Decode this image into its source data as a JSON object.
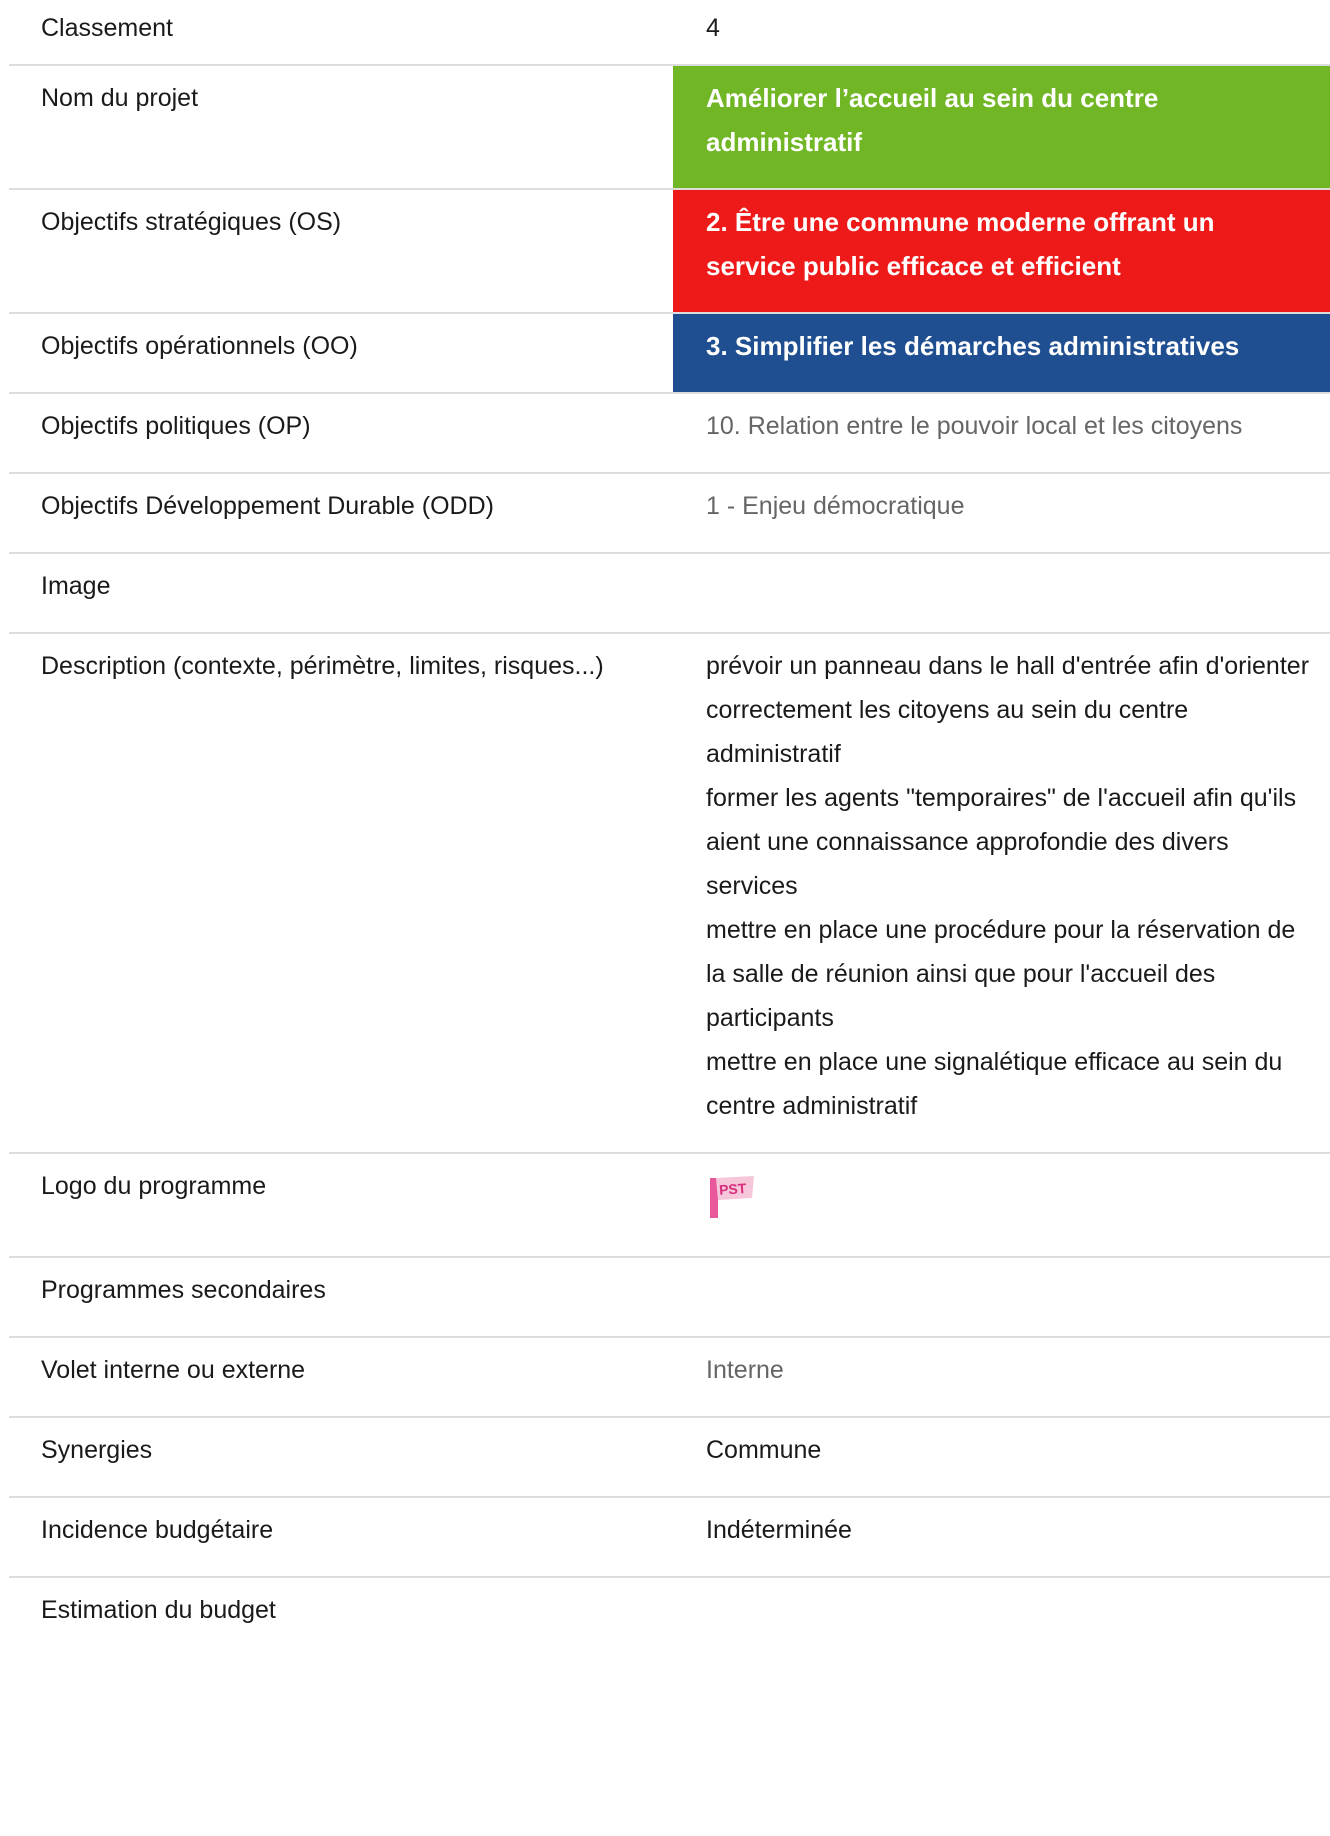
{
  "colors": {
    "green": "#70b625",
    "red": "#ee1a1a",
    "blue": "#1f4f91",
    "muted_text": "#666666",
    "divider": "#dcdcdc"
  },
  "rows": {
    "classement": {
      "label": "Classement",
      "value": "4"
    },
    "nom_projet": {
      "label": "Nom du projet",
      "value": "Améliorer l’accueil au sein du centre administratif"
    },
    "os": {
      "label": "Objectifs stratégiques (OS)",
      "value": "2. Être une commune moderne offrant un service public efficace et efficient"
    },
    "oo": {
      "label": "Objectifs opérationnels (OO)",
      "value": "3. Simplifier les démarches administratives"
    },
    "op": {
      "label": "Objectifs politiques (OP)",
      "value": "10. Relation entre le pouvoir local et les citoyens"
    },
    "odd": {
      "label": "Objectifs Développement Durable (ODD)",
      "value": "1 - Enjeu démocratique"
    },
    "image": {
      "label": "Image",
      "value": ""
    },
    "description": {
      "label": "Description (contexte, périmètre, limites, risques...)",
      "lines": [
        "prévoir un panneau dans le hall d'entrée afin d'orienter correctement les citoyens au sein du centre administratif",
        "former les agents \"temporaires\" de l'accueil afin qu'ils aient une connaissance approfondie des divers services",
        "mettre en place une procédure pour la réservation de la salle de réunion ainsi que pour l'accueil des participants",
        "mettre en place une signalétique efficace au sein du centre administratif"
      ]
    },
    "logo": {
      "label": "Logo du programme",
      "logo_text": "PST",
      "icon": "pst-flag-logo"
    },
    "programmes_secondaires": {
      "label": "Programmes secondaires",
      "value": ""
    },
    "volet": {
      "label": "Volet interne ou externe",
      "value": "Interne"
    },
    "synergies": {
      "label": "Synergies",
      "value": "Commune"
    },
    "incidence": {
      "label": "Incidence budgétaire",
      "value": "Indéterminée"
    },
    "estimation": {
      "label": "Estimation du budget",
      "value": ""
    }
  }
}
